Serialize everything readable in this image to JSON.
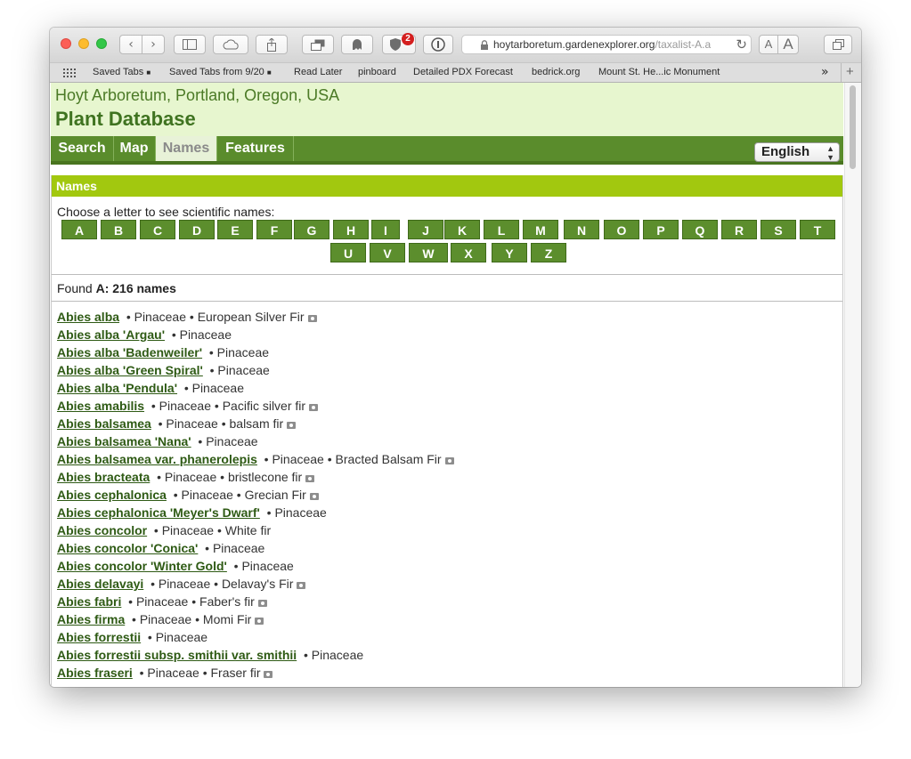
{
  "browser": {
    "url_host": "hoytarboretum.gardenexplorer.org",
    "url_path": "/taxalist-A.a",
    "blocker_badge": "2",
    "font_small_label": "A",
    "font_large_label": "A",
    "bookmarks": [
      "Saved Tabs",
      "Saved Tabs from 9/20",
      "Read Later",
      "pinboard",
      "Detailed PDX Forecast",
      "bedrick.org",
      "Mount St. He...ic Monument"
    ],
    "overflow_label": "»",
    "new_tab_label": "+"
  },
  "header": {
    "location": "Hoyt Arboretum, Portland, Oregon, USA",
    "title": "Plant Database"
  },
  "nav": {
    "tabs": [
      "Search",
      "Map",
      "Names",
      "Features"
    ],
    "active": "Names",
    "language": "English"
  },
  "names": {
    "heading": "Names",
    "instruction": "Choose a letter to see scientific names:",
    "letters_row1": [
      "A",
      "B",
      "C",
      "D",
      "E",
      "F",
      "G",
      "H",
      "I",
      "J",
      "K",
      "L",
      "M",
      "N",
      "O",
      "P",
      "Q",
      "R",
      "S",
      "T"
    ],
    "letters_row2": [
      "U",
      "V",
      "W",
      "X",
      "Y",
      "Z"
    ],
    "found_prefix": "Found ",
    "found_bold": "A: 216 names"
  },
  "plants": [
    {
      "name": "Abies alba",
      "family": "Pinaceae",
      "common": "European Silver Fir",
      "photo": true
    },
    {
      "name": "Abies alba 'Argau'",
      "family": "Pinaceae",
      "common": "",
      "photo": false
    },
    {
      "name": "Abies alba 'Badenweiler'",
      "family": "Pinaceae",
      "common": "",
      "photo": false
    },
    {
      "name": "Abies alba 'Green Spiral'",
      "family": "Pinaceae",
      "common": "",
      "photo": false
    },
    {
      "name": "Abies alba 'Pendula'",
      "family": "Pinaceae",
      "common": "",
      "photo": false
    },
    {
      "name": "Abies amabilis",
      "family": "Pinaceae",
      "common": "Pacific silver fir",
      "photo": true
    },
    {
      "name": "Abies balsamea",
      "family": "Pinaceae",
      "common": "balsam fir",
      "photo": true
    },
    {
      "name": "Abies balsamea 'Nana'",
      "family": "Pinaceae",
      "common": "",
      "photo": false
    },
    {
      "name": "Abies balsamea var. phanerolepis",
      "family": "Pinaceae",
      "common": "Bracted Balsam Fir",
      "photo": true
    },
    {
      "name": "Abies bracteata",
      "family": "Pinaceae",
      "common": "bristlecone fir",
      "photo": true
    },
    {
      "name": "Abies cephalonica",
      "family": "Pinaceae",
      "common": "Grecian Fir",
      "photo": true
    },
    {
      "name": "Abies cephalonica 'Meyer's Dwarf'",
      "family": "Pinaceae",
      "common": "",
      "photo": false
    },
    {
      "name": "Abies concolor",
      "family": "Pinaceae",
      "common": "White fir",
      "photo": false
    },
    {
      "name": "Abies concolor 'Conica'",
      "family": "Pinaceae",
      "common": "",
      "photo": false
    },
    {
      "name": "Abies concolor 'Winter Gold'",
      "family": "Pinaceae",
      "common": "",
      "photo": false
    },
    {
      "name": "Abies delavayi",
      "family": "Pinaceae",
      "common": "Delavay's Fir",
      "photo": true
    },
    {
      "name": "Abies fabri",
      "family": "Pinaceae",
      "common": "Faber's fir",
      "photo": true
    },
    {
      "name": "Abies firma",
      "family": "Pinaceae",
      "common": "Momi Fir",
      "photo": true
    },
    {
      "name": "Abies forrestii",
      "family": "Pinaceae",
      "common": "",
      "photo": false
    },
    {
      "name": "Abies forrestii subsp. smithii var. smithii",
      "family": "Pinaceae",
      "common": "",
      "photo": false
    },
    {
      "name": "Abies fraseri",
      "family": "Pinaceae",
      "common": "Fraser fir",
      "photo": true
    }
  ],
  "separator": "•",
  "colors": {
    "header_bg": "#e7f6cf",
    "nav_green": "#5a8c2c",
    "panel_head": "#a2c80f",
    "link": "#2e5a14"
  }
}
